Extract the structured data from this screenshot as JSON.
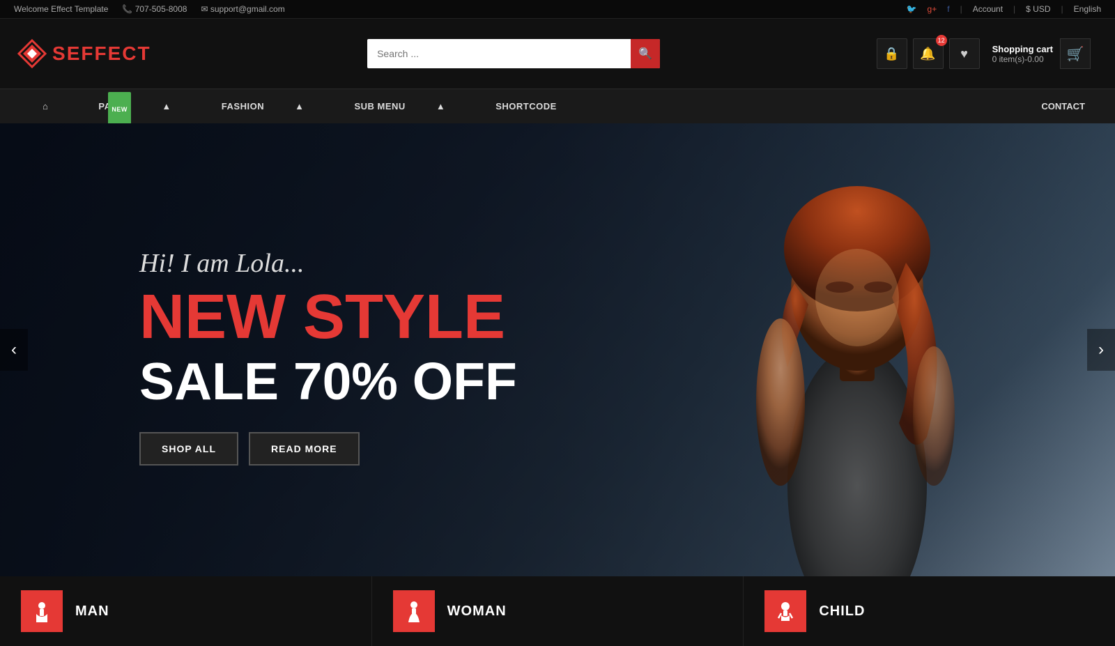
{
  "topbar": {
    "welcome": "Welcome Effect Template",
    "phone": "707-505-8008",
    "email": "support@gmail.com",
    "account": "Account",
    "currency": "$ USD",
    "language": "English"
  },
  "header": {
    "logo_text": "EFFECT",
    "search_placeholder": "Search ...",
    "search_button_label": "Search",
    "cart_title": "Shopping cart",
    "cart_items": "0 item(s)-0.00"
  },
  "nav": {
    "home": "Home",
    "pages": "PAGES",
    "fashion": "FASHION",
    "submenu": "SUB MENU",
    "shortcode": "SHORTCODE",
    "contact": "CONTACT",
    "pages_badge": "NEW"
  },
  "hero": {
    "subtitle": "Hi! I am Lola...",
    "title_line1": "NEW STYLE",
    "title_line2": "SALE 70% OFF",
    "btn_shop": "SHOP ALL",
    "btn_read": "READ MORE"
  },
  "categories": [
    {
      "id": "man",
      "label": "MAN",
      "icon": "♂"
    },
    {
      "id": "woman",
      "label": "WOMAN",
      "icon": "♀"
    },
    {
      "id": "child",
      "label": "CHILD",
      "icon": "☺"
    }
  ],
  "colors": {
    "accent": "#e53935",
    "bg_dark": "#111",
    "bg_nav": "#1a1a1a",
    "text_light": "#ddd",
    "badge_green": "#4caf50"
  }
}
